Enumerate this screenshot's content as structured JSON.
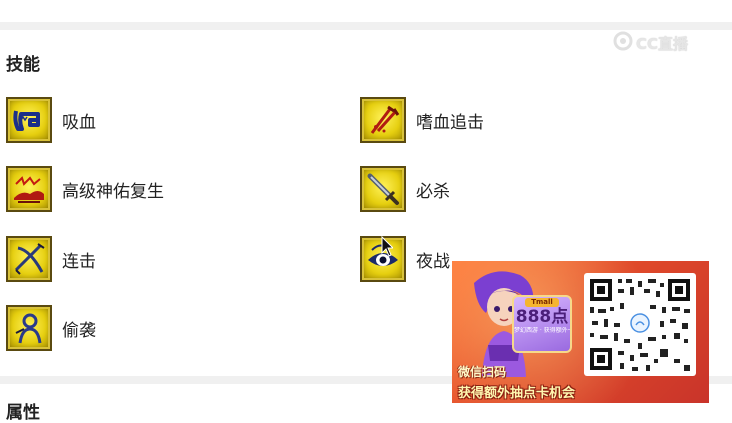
{
  "section": {
    "title": "技能"
  },
  "skills": [
    {
      "name": "吸血",
      "icon": "blood-suck-icon"
    },
    {
      "name": "嗜血追击",
      "icon": "blood-pursuit-icon"
    },
    {
      "name": "高级神佑复生",
      "icon": "divine-revive-icon"
    },
    {
      "name": "必杀",
      "icon": "sword-icon"
    },
    {
      "name": "连击",
      "icon": "combo-strike-icon"
    },
    {
      "name": "夜战",
      "icon": "night-eye-icon"
    },
    {
      "name": "偷袭",
      "icon": "sneak-attack-icon"
    }
  ],
  "next_section": {
    "title": "属性"
  },
  "watermark": {
    "text": "CC直播",
    "icon": "cc-logo-icon"
  },
  "ad": {
    "prize_tag": "Tmall",
    "prize_amount": "888点",
    "prize_sub": "梦幻西游 · 获得额外一次",
    "scan_text": "微信扫码",
    "headline": "获得额外抽点卡机会",
    "colors": {
      "bg_start": "#ff7a3c",
      "bg_end": "#c9342a",
      "text": "#fff7b0"
    }
  }
}
